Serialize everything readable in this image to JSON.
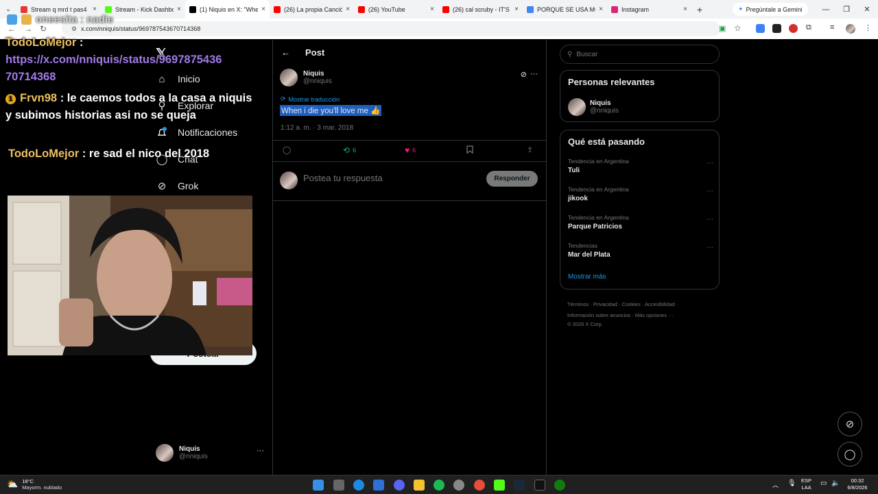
{
  "browser": {
    "tabs": [
      {
        "label": "Stream q mrd t pas4",
        "color": "#e53935"
      },
      {
        "label": "Stream - Kick Dashbo",
        "color": "#53fc18"
      },
      {
        "label": "(1) Niquis en X: \"Whe",
        "color": "#000000",
        "active": true
      },
      {
        "label": "(26) La propia Canció",
        "color": "#ff0000"
      },
      {
        "label": "(26) YouTube",
        "color": "#ff0000"
      },
      {
        "label": "(26) cal scruby - IT'S",
        "color": "#ff0000"
      },
      {
        "label": "PORQUE SE USA MO",
        "color": "#4285f4"
      },
      {
        "label": "Instagram",
        "color": "#d62976"
      }
    ],
    "tab_close": "×",
    "new_tab": "+",
    "gemini": "Pregúntale a Gemini",
    "url": "x.com/nniquis/status/969787543670714368",
    "window_controls": [
      "—",
      "❐",
      "✕"
    ]
  },
  "stream_overlay": {
    "ghost_line": "oneesita : nadie",
    "messages": [
      {
        "user": "TodoLoMejor",
        "text": " :",
        "link": "https://x.com/nniquis/status/969787543670714368"
      },
      {
        "user": "Frvn98",
        "badge": "1",
        "text": " : le caemos todos a la casa a niquis y subimos historias asi no se queja"
      },
      {
        "user": "TodoLoMejor",
        "text": " : re sad el nico del 2018"
      }
    ]
  },
  "xnav": {
    "items": [
      {
        "label": "Inicio",
        "icon": "home-icon",
        "glyph": "⌂"
      },
      {
        "label": "Explorar",
        "icon": "search-icon",
        "glyph": "⚲"
      },
      {
        "label": "Notificaciones",
        "icon": "bell-icon",
        "glyph": "🔔"
      },
      {
        "label": "Chat",
        "icon": "chat-icon",
        "glyph": "◯"
      },
      {
        "label": "Grok",
        "icon": "grok-icon",
        "glyph": "⊘"
      }
    ],
    "post_button": "Postear",
    "account": {
      "name": "Niquis",
      "handle": "@nniquis"
    }
  },
  "post": {
    "header": "Post",
    "author": {
      "name": "Niquis",
      "handle": "@nniquis"
    },
    "translate": "Mostrar traducción",
    "text": "When i die you'll love me 👍",
    "date": "1:12 a. m. · 3 mar. 2018",
    "stats": {
      "reposts": "6",
      "likes": "6"
    },
    "reply_placeholder": "Postea tu respuesta",
    "reply_button": "Responder"
  },
  "sidebar": {
    "search_placeholder": "Buscar",
    "relevant_title": "Personas relevantes",
    "relevant_person": {
      "name": "Niquis",
      "handle": "@nniquis"
    },
    "trends_title": "Qué está pasando",
    "trends": [
      {
        "category": "Tendencia en Argentina",
        "name": "Tuli"
      },
      {
        "category": "Tendencia en Argentina",
        "name": "jikook"
      },
      {
        "category": "Tendencia en Argentina",
        "name": "Parque Patricios"
      },
      {
        "category": "Tendencias",
        "name": "Mar del Plata"
      }
    ],
    "show_more": "Mostrar más",
    "footer_line1": "Términos · Privacidad · Cookies · Accesibilidad ·",
    "footer_line2": "Información sobre anuncios · Más opciones ···",
    "footer_line3": "© 2026 X Corp."
  },
  "taskbar": {
    "temp": "18°C",
    "weather": "Mayorm. nublado",
    "lang1": "ESP",
    "lang2": "LAA",
    "time": "00:32",
    "date": "6/8/2026"
  },
  "colors": {
    "accent": "#1d9bf0",
    "like": "#f91880",
    "repost": "#00ba7c"
  }
}
